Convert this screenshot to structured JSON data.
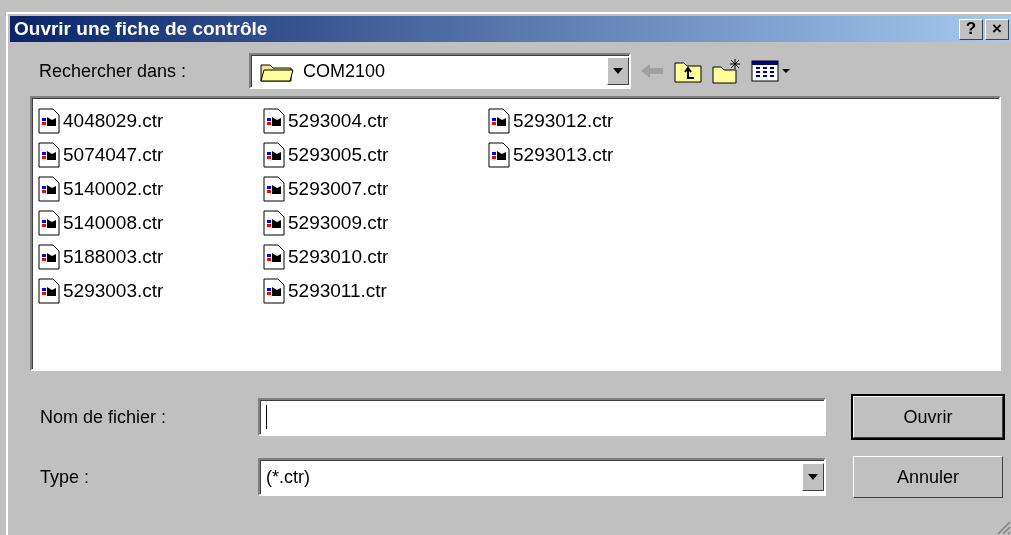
{
  "window": {
    "title": "Ouvrir une fiche de contrôle",
    "buttons": [
      "?",
      "×"
    ]
  },
  "look_in": {
    "label": "Rechercher dans :",
    "value": "COM2100"
  },
  "files": [
    {
      "name": "4048029.ctr",
      "selected": false
    },
    {
      "name": "5074047.ctr",
      "selected": false
    },
    {
      "name": "5140002.ctr",
      "selected": false
    },
    {
      "name": "5140008.ctr",
      "selected": false
    },
    {
      "name": "5188003.ctr",
      "selected": false
    },
    {
      "name": "5293003.ctr",
      "selected": false
    },
    {
      "name": "5293004.ctr",
      "selected": false
    },
    {
      "name": "5293005.ctr",
      "selected": false
    },
    {
      "name": "5293007.ctr",
      "selected": false
    },
    {
      "name": "5293009.ctr",
      "selected": false
    },
    {
      "name": "5293010.ctr",
      "selected": false
    },
    {
      "name": "5293011.ctr",
      "selected": false
    },
    {
      "name": "5293012.ctr",
      "selected": false
    },
    {
      "name": "5293013.ctr",
      "selected": false
    }
  ],
  "filename": {
    "label": "Nom de fichier :"
  },
  "type": {
    "label": "Type :",
    "value": "(*.ctr)"
  },
  "buttons": [
    {
      "label": "Ouvrir",
      "default": true
    },
    {
      "label": "Annuler",
      "default": false
    }
  ]
}
